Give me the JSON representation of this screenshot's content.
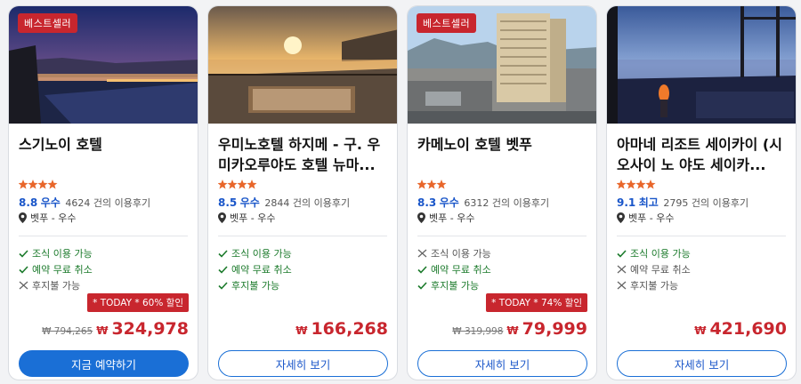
{
  "colors": {
    "accent": "#1a6fd6",
    "sale": "#c8262e",
    "score": "#1a56c9",
    "ok": "#1b7a2b"
  },
  "cards": [
    {
      "badge": "베스트셀러",
      "name": "스기노이 호텔",
      "stars": 4,
      "score": "8.8",
      "score_word": "우수",
      "reviews": "4624 건의 이용후기",
      "location": "벳푸 - 우수",
      "amenities": [
        {
          "ok": true,
          "label": "조식 이용 가능"
        },
        {
          "ok": true,
          "label": "예약 무료 취소"
        },
        {
          "ok": false,
          "label": "후지불 가능"
        }
      ],
      "deal": "* TODAY * 60% 할인",
      "original_price": "₩ 794,265",
      "currency": "₩",
      "price": "324,978",
      "button": "지금 예약하기",
      "button_primary": true
    },
    {
      "badge": "",
      "name": "우미노호텔 하지메 - 구. 우미카오루야도 호텔 뉴마...",
      "stars": 4,
      "score": "8.5",
      "score_word": "우수",
      "reviews": "2844 건의 이용후기",
      "location": "벳푸 - 우수",
      "amenities": [
        {
          "ok": true,
          "label": "조식 이용 가능"
        },
        {
          "ok": true,
          "label": "예약 무료 취소"
        },
        {
          "ok": true,
          "label": "후지불 가능"
        }
      ],
      "deal": "",
      "original_price": "",
      "currency": "₩",
      "price": "166,268",
      "button": "자세히 보기",
      "button_primary": false
    },
    {
      "badge": "베스트셀러",
      "name": "카메노이 호텔 벳푸",
      "stars": 3.5,
      "score": "8.3",
      "score_word": "우수",
      "reviews": "6312 건의 이용후기",
      "location": "벳푸 - 우수",
      "amenities": [
        {
          "ok": false,
          "label": "조식 이용 가능"
        },
        {
          "ok": true,
          "label": "예약 무료 취소"
        },
        {
          "ok": true,
          "label": "후지불 가능"
        }
      ],
      "deal": "* TODAY * 74% 할인",
      "original_price": "₩ 319,998",
      "currency": "₩",
      "price": "79,999",
      "button": "자세히 보기",
      "button_primary": false
    },
    {
      "badge": "",
      "name": "아마네 리조트 세이카이 (시오사이 노 야도 세이카...",
      "stars": 4.5,
      "score": "9.1",
      "score_word": "최고",
      "reviews": "2795 건의 이용후기",
      "location": "벳푸 - 우수",
      "amenities": [
        {
          "ok": true,
          "label": "조식 이용 가능"
        },
        {
          "ok": false,
          "label": "예약 무료 취소"
        },
        {
          "ok": false,
          "label": "후지불 가능"
        }
      ],
      "deal": "",
      "original_price": "",
      "currency": "₩",
      "price": "421,690",
      "button": "자세히 보기",
      "button_primary": false
    }
  ]
}
